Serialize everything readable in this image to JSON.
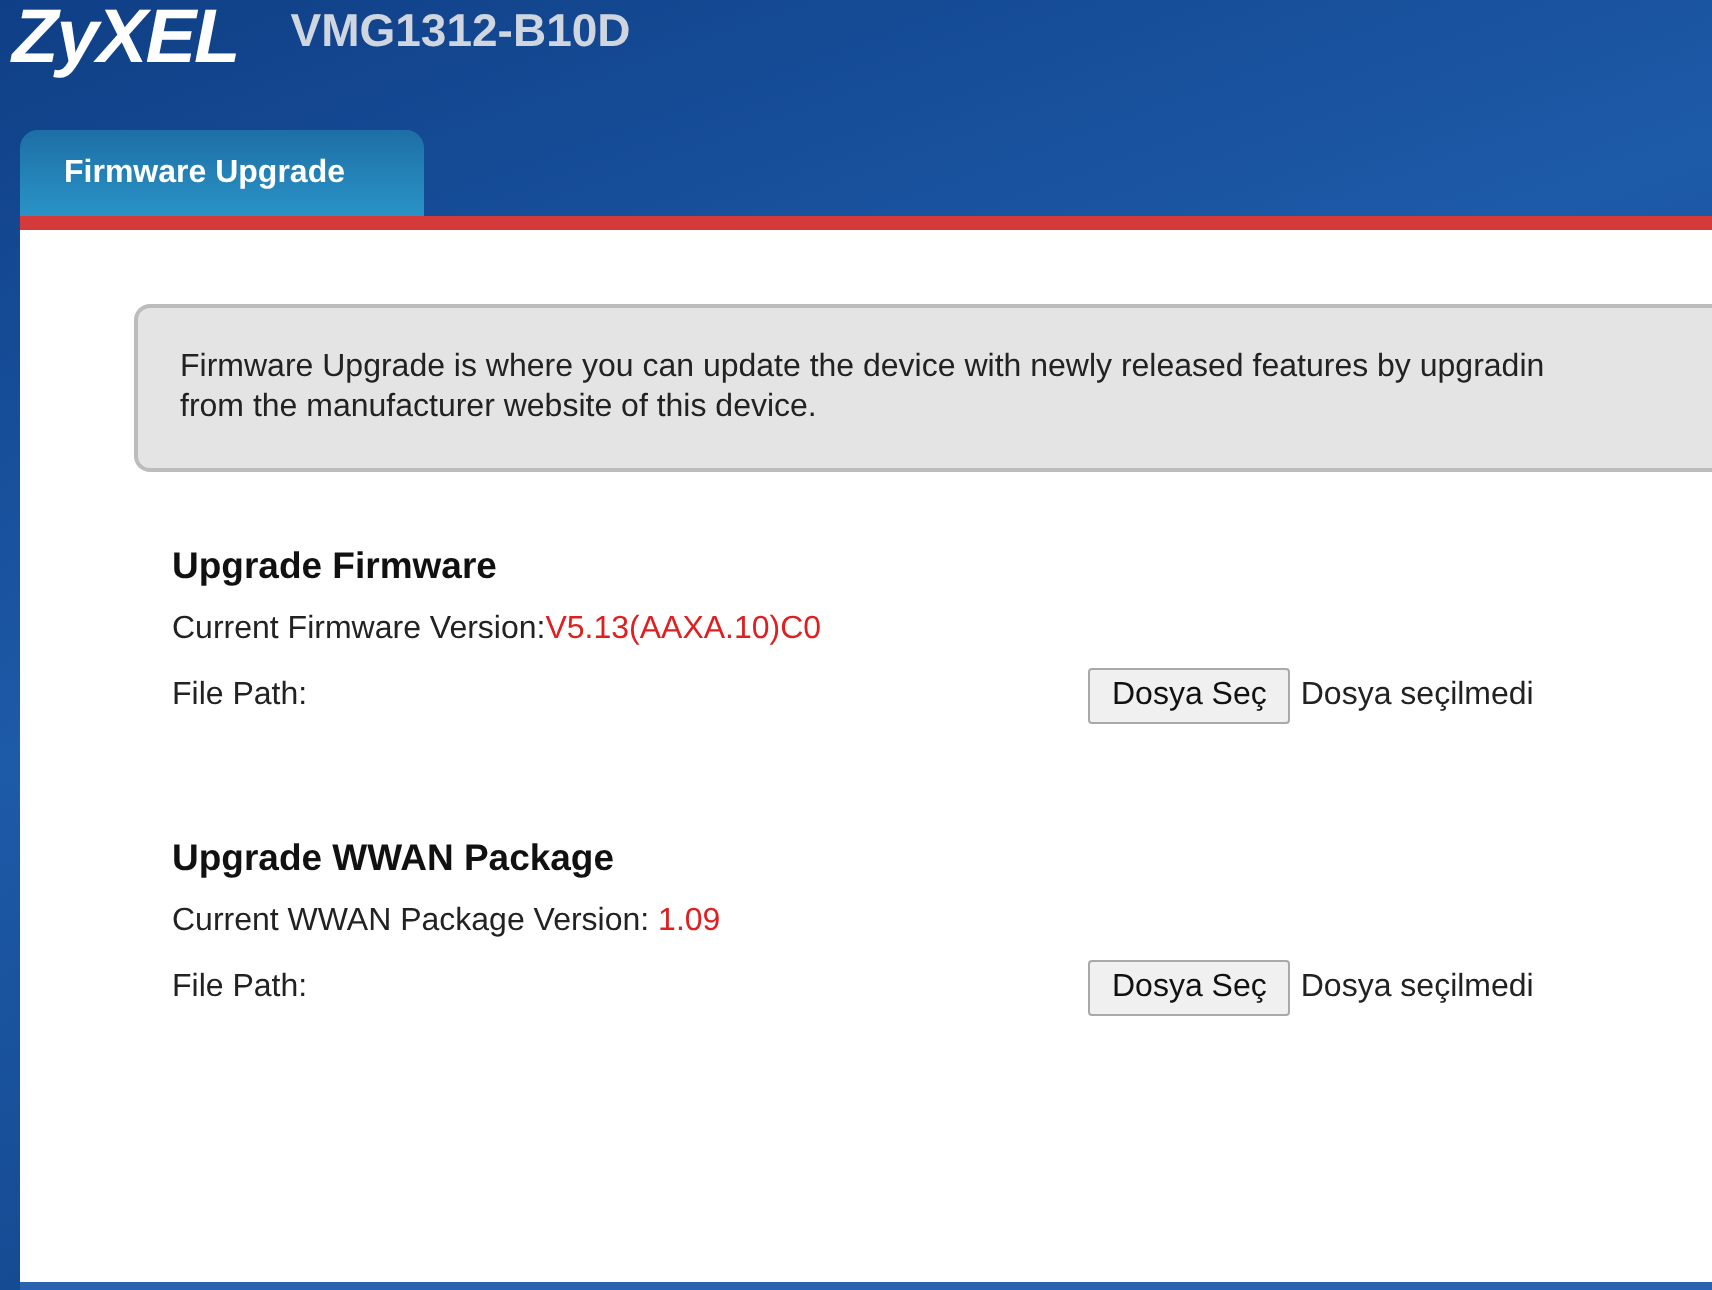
{
  "header": {
    "logo": "ZyXEL",
    "model": "VMG1312-B10D"
  },
  "tabs": [
    {
      "label": "Firmware Upgrade",
      "selected": true
    }
  ],
  "description": [
    "Firmware Upgrade is where you can update the device with newly released features by upgradin",
    "from the manufacturer website of this device."
  ],
  "sections": [
    {
      "title": "Upgrade Firmware",
      "version_label": "Current Firmware Version:",
      "version_value": "V5.13(AAXA.10)C0",
      "file_label": "File Path:",
      "button": "Dosya Seç",
      "file_status": "Dosya seçilmedi"
    },
    {
      "title": "Upgrade WWAN Package",
      "version_label": "Current WWAN Package Version: ",
      "version_value": "1.09",
      "file_label": "File Path:",
      "button": "Dosya Seç",
      "file_status": "Dosya seçilmedi"
    }
  ]
}
